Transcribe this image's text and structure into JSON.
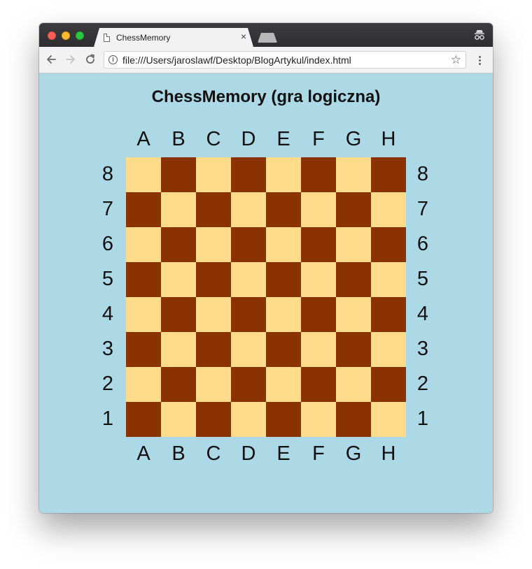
{
  "browser": {
    "tab_title": "ChessMemory",
    "tab_close": "×",
    "url": "file:///Users/jaroslawf/Desktop/BlogArtykul/index.html",
    "icons": {
      "back": "arrow-left-icon",
      "forward": "arrow-right-icon",
      "reload": "reload-icon",
      "info": "info-icon",
      "bookmark": "star-icon",
      "menu": "kebab-menu-icon",
      "incognito": "incognito-icon"
    }
  },
  "page": {
    "title": "ChessMemory (gra logiczna)"
  },
  "board": {
    "files": [
      "A",
      "B",
      "C",
      "D",
      "E",
      "F",
      "G",
      "H"
    ],
    "ranks": [
      "8",
      "7",
      "6",
      "5",
      "4",
      "3",
      "2",
      "1"
    ],
    "light_color": "#fedc8c",
    "dark_color": "#8b3300",
    "background_color": "#add8e6"
  }
}
